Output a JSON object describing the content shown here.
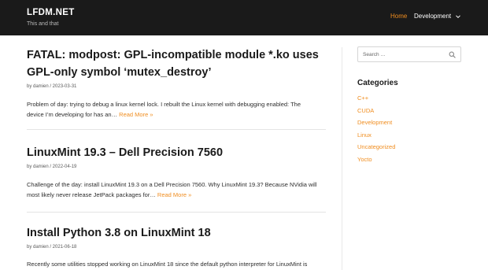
{
  "site": {
    "title": "LFDM.NET",
    "tagline": "This and that"
  },
  "nav": {
    "items": [
      {
        "label": "Home",
        "active": true
      },
      {
        "label": "Development",
        "active": false
      }
    ]
  },
  "posts": [
    {
      "title_line1": "FATAL: modpost: GPL-incompatible module *.ko uses",
      "title_line2": "GPL-only symbol ‘mutex_destroy’",
      "meta": "by damien / 2023-03-31",
      "excerpt_line1": "Problem of day: trying to debug a linux kernel lock. I rebuilt the Linux kernel with debugging enabled: The",
      "excerpt_line2": "device I’m developing for has an…",
      "read_more": "Read More »"
    },
    {
      "title_line1": "LinuxMint 19.3 – Dell Precision 7560",
      "meta": "by damien / 2022-04-19",
      "excerpt_line1": "Challenge of the day: install LinuxMint 19.3 on a Dell Precision 7560. Why LinuxMint 19.3? Because NVidia will",
      "excerpt_line2": "most likely never release JetPack packages for…",
      "read_more": "Read More »"
    },
    {
      "title_line1": "Install Python 3.8 on LinuxMint 18",
      "meta": "by damien / 2021-06-18",
      "excerpt_line1": "Recently some utilities stopped working on LinuxMint 18 since the default python interpreter for LinuxMint is"
    }
  ],
  "sidebar": {
    "search_placeholder": "Search …",
    "categories_heading": "Categories",
    "categories": [
      "C++",
      "CUDA",
      "Development",
      "Linux",
      "Uncategorized",
      "Yocto"
    ]
  },
  "colors": {
    "accent": "#f08d1f",
    "header_bg": "#1a1a1a"
  },
  "icons": {
    "nav_dropdown": "chevron-down-icon",
    "search": "search-icon"
  }
}
